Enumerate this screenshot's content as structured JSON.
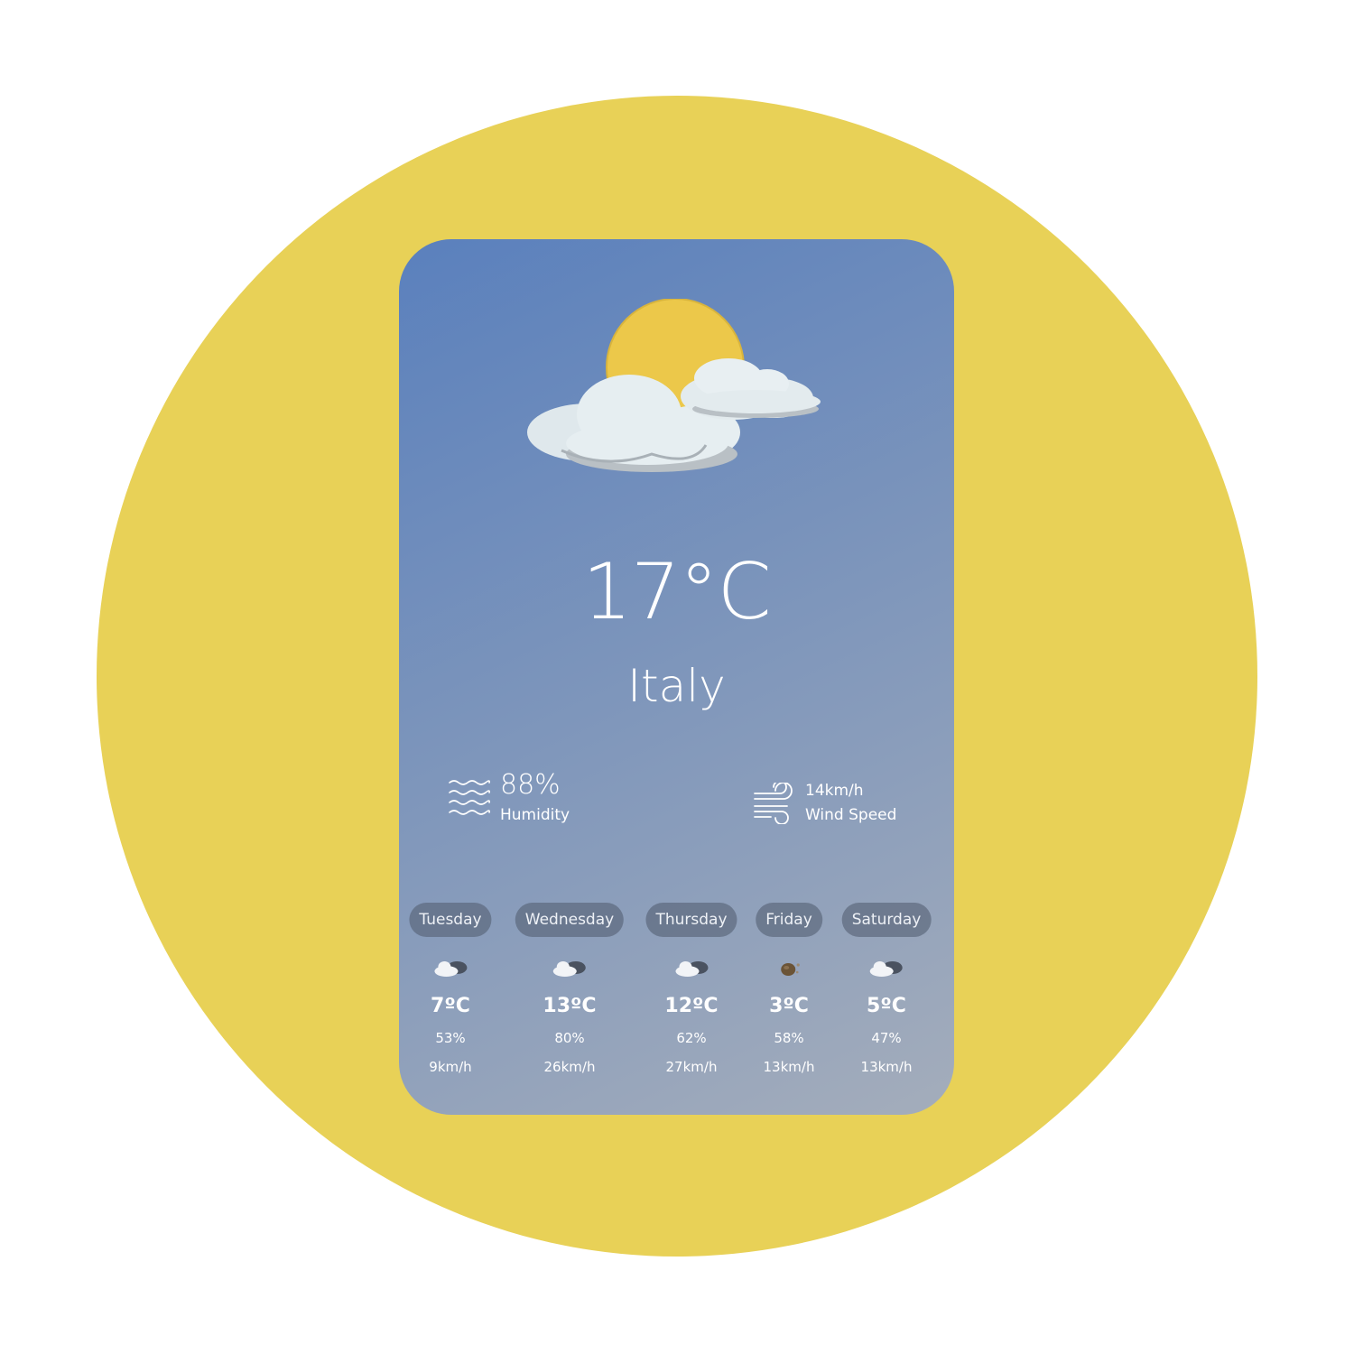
{
  "current": {
    "temperature": "17°C",
    "location": "Italy",
    "condition_icon": "sun-behind-cloud-icon"
  },
  "stats": {
    "humidity": {
      "value": "88%",
      "label": "Humidity",
      "icon": "humidity-waves-icon"
    },
    "wind": {
      "value": "14km/h",
      "label": "Wind Speed",
      "icon": "wind-icon"
    }
  },
  "forecast": [
    {
      "day": "Tuesday",
      "icon": "cloudy-icon",
      "temp": "7ºC",
      "humidity": "53%",
      "wind": "9km/h"
    },
    {
      "day": "Wednesday",
      "icon": "cloudy-icon",
      "temp": "13ºC",
      "humidity": "80%",
      "wind": "26km/h"
    },
    {
      "day": "Thursday",
      "icon": "cloudy-icon",
      "temp": "12ºC",
      "humidity": "62%",
      "wind": "27km/h"
    },
    {
      "day": "Friday",
      "icon": "hail-icon",
      "temp": "3ºC",
      "humidity": "58%",
      "wind": "13km/h"
    },
    {
      "day": "Saturday",
      "icon": "cloudy-icon",
      "temp": "5ºC",
      "humidity": "47%",
      "wind": "13km/h"
    }
  ],
  "colors": {
    "background_circle": "#e8d157",
    "card_gradient_start": "#5a80bd",
    "card_gradient_end": "#a4adbb",
    "day_pill": "#556175"
  }
}
